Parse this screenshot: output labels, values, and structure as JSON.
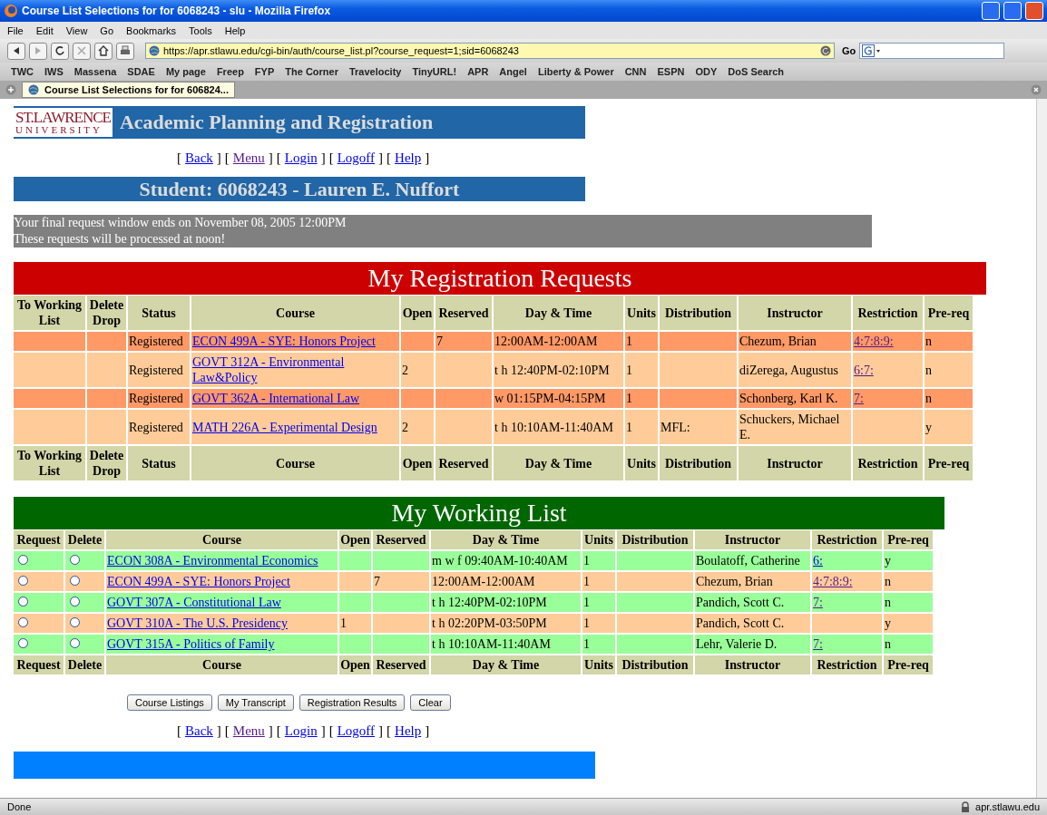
{
  "window": {
    "title": "Course List Selections for for 6068243 - slu - Mozilla Firefox"
  },
  "menu": [
    "File",
    "Edit",
    "View",
    "Go",
    "Bookmarks",
    "Tools",
    "Help"
  ],
  "toolbar": {
    "url": "https://apr.stlawu.edu/cgi-bin/auth/course_list.pl?course_request=1;sid=6068243",
    "go_label": "Go"
  },
  "bookmarks": [
    "TWC",
    "IWS",
    "Massena",
    "SDAE",
    "My page",
    "Freep",
    "FYP",
    "The Corner",
    "Travelocity",
    "TinyURL!",
    "APR",
    "Angel",
    "Liberty & Power",
    "CNN",
    "ESPN",
    "ODY",
    "DoS Search"
  ],
  "tabs": [
    {
      "label": "Course List Selections for for 606824...",
      "selected": true
    }
  ],
  "page": {
    "logo": {
      "line_1": "ST.LAWRENCE",
      "line_2": "UNIVERSITY"
    },
    "title": "Academic Planning and Registration",
    "nav_top": [
      {
        "open": "[",
        "label": "Back",
        "close": "]",
        "visited": false
      },
      {
        "open": "[",
        "label": "Menu",
        "close": "]",
        "visited": true
      },
      {
        "open": "[",
        "label": "Login",
        "close": "]",
        "visited": false
      },
      {
        "open": "[",
        "label": "Logoff",
        "close": "]",
        "visited": false
      },
      {
        "open": "[",
        "label": "Help",
        "close": "]",
        "visited": false
      }
    ],
    "student": "Student: 6068243 - Lauren E. Nuffort",
    "notice": [
      "Your final request window ends on November 08, 2005 12:00PM",
      "These requests will be processed at noon!"
    ],
    "requests": {
      "title": "My Registration Requests",
      "columns": [
        "To Working List",
        "Delete Drop",
        "Status",
        "Course",
        "Open",
        "Reserved",
        "Day & Time",
        "Units",
        "Distribution",
        "Instructor",
        "Restriction",
        "Pre-req"
      ],
      "rows": [
        {
          "color": "#ff9966",
          "cells": [
            {
              "kind": "blank"
            },
            {
              "kind": "blank"
            },
            {
              "kind": "text",
              "text": "Registered"
            },
            {
              "kind": "link",
              "text": "ECON 499A - SYE: Honors Project",
              "visited": false
            },
            {
              "kind": "blank"
            },
            {
              "kind": "text",
              "text": "7"
            },
            {
              "kind": "text",
              "text": "12:00AM-12:00AM"
            },
            {
              "kind": "text",
              "text": "1"
            },
            {
              "kind": "blank"
            },
            {
              "kind": "text",
              "text": "Chezum, Brian"
            },
            {
              "kind": "link",
              "text": "4:7:8:9:",
              "visited": true
            },
            {
              "kind": "text",
              "text": "n"
            }
          ]
        },
        {
          "color": "#ffcc99",
          "cells": [
            {
              "kind": "blank"
            },
            {
              "kind": "blank"
            },
            {
              "kind": "text",
              "text": "Registered"
            },
            {
              "kind": "link",
              "text": "GOVT 312A - Environmental Law&Policy",
              "visited": false
            },
            {
              "kind": "text",
              "text": "2"
            },
            {
              "kind": "blank"
            },
            {
              "kind": "text",
              "text": "t h 12:40PM-02:10PM"
            },
            {
              "kind": "text",
              "text": "1"
            },
            {
              "kind": "blank"
            },
            {
              "kind": "text",
              "text": "diZerega, Augustus"
            },
            {
              "kind": "link",
              "text": "6:7:",
              "visited": true
            },
            {
              "kind": "text",
              "text": "n"
            }
          ]
        },
        {
          "color": "#ff9966",
          "cells": [
            {
              "kind": "blank"
            },
            {
              "kind": "blank"
            },
            {
              "kind": "text",
              "text": "Registered"
            },
            {
              "kind": "link",
              "text": "GOVT 362A - International Law",
              "visited": false
            },
            {
              "kind": "blank"
            },
            {
              "kind": "blank"
            },
            {
              "kind": "text",
              "text": "w 01:15PM-04:15PM"
            },
            {
              "kind": "text",
              "text": "1"
            },
            {
              "kind": "blank"
            },
            {
              "kind": "text",
              "text": "Schonberg, Karl K."
            },
            {
              "kind": "link",
              "text": "7:",
              "visited": true
            },
            {
              "kind": "text",
              "text": "n"
            }
          ]
        },
        {
          "color": "#ffcc99",
          "cells": [
            {
              "kind": "blank"
            },
            {
              "kind": "blank"
            },
            {
              "kind": "text",
              "text": "Registered"
            },
            {
              "kind": "link",
              "text": "MATH 226A - Experimental Design",
              "visited": false
            },
            {
              "kind": "text",
              "text": "2"
            },
            {
              "kind": "blank"
            },
            {
              "kind": "text",
              "text": "t h 10:10AM-11:40AM"
            },
            {
              "kind": "text",
              "text": "1"
            },
            {
              "kind": "text",
              "text": "MFL:"
            },
            {
              "kind": "text",
              "text": "Schuckers, Michael E."
            },
            {
              "kind": "blank"
            },
            {
              "kind": "text",
              "text": "y"
            }
          ]
        }
      ],
      "footer_columns": [
        "To Working List",
        "Delete Drop",
        "Status",
        "Course",
        "Open",
        "Reserved",
        "Day & Time",
        "Units",
        "Distribution",
        "Instructor",
        "Restriction",
        "Pre-req"
      ]
    },
    "working": {
      "title": "My Working List",
      "columns": [
        "Request",
        "Delete",
        "Course",
        "Open",
        "Reserved",
        "Day & Time",
        "Units",
        "Distribution",
        "Instructor",
        "Restriction",
        "Pre-req"
      ],
      "rows": [
        {
          "color": "#99ff99",
          "cells": [
            {
              "kind": "radio",
              "selected": false
            },
            {
              "kind": "radio",
              "selected": false
            },
            {
              "kind": "link",
              "text": "ECON 308A - Environmental Economics",
              "visited": false
            },
            {
              "kind": "blank"
            },
            {
              "kind": "blank"
            },
            {
              "kind": "text",
              "text": "m w f 09:40AM-10:40AM"
            },
            {
              "kind": "text",
              "text": "1"
            },
            {
              "kind": "blank"
            },
            {
              "kind": "text",
              "text": "Boulatoff, Catherine"
            },
            {
              "kind": "link",
              "text": "6:",
              "visited": false
            },
            {
              "kind": "text",
              "text": "y"
            }
          ]
        },
        {
          "color": "#ffcc99",
          "cells": [
            {
              "kind": "radio",
              "selected": false
            },
            {
              "kind": "radio",
              "selected": false
            },
            {
              "kind": "link",
              "text": "ECON 499A - SYE: Honors Project",
              "visited": false
            },
            {
              "kind": "blank"
            },
            {
              "kind": "text",
              "text": "7"
            },
            {
              "kind": "text",
              "text": "12:00AM-12:00AM"
            },
            {
              "kind": "text",
              "text": "1"
            },
            {
              "kind": "blank"
            },
            {
              "kind": "text",
              "text": "Chezum, Brian"
            },
            {
              "kind": "link",
              "text": "4:7:8:9:",
              "visited": true
            },
            {
              "kind": "text",
              "text": "n"
            }
          ]
        },
        {
          "color": "#99ff99",
          "cells": [
            {
              "kind": "radio",
              "selected": false
            },
            {
              "kind": "radio",
              "selected": false
            },
            {
              "kind": "link",
              "text": "GOVT 307A - Constitutional Law",
              "visited": false
            },
            {
              "kind": "blank"
            },
            {
              "kind": "blank"
            },
            {
              "kind": "text",
              "text": "t h 12:40PM-02:10PM"
            },
            {
              "kind": "text",
              "text": "1"
            },
            {
              "kind": "blank"
            },
            {
              "kind": "text",
              "text": "Pandich, Scott C."
            },
            {
              "kind": "link",
              "text": "7:",
              "visited": true
            },
            {
              "kind": "text",
              "text": "n"
            }
          ]
        },
        {
          "color": "#ffcc99",
          "cells": [
            {
              "kind": "radio",
              "selected": false
            },
            {
              "kind": "radio",
              "selected": false
            },
            {
              "kind": "link",
              "text": "GOVT 310A - The U.S. Presidency",
              "visited": false
            },
            {
              "kind": "text",
              "text": "1"
            },
            {
              "kind": "blank"
            },
            {
              "kind": "text",
              "text": "t h 02:20PM-03:50PM"
            },
            {
              "kind": "text",
              "text": "1"
            },
            {
              "kind": "blank"
            },
            {
              "kind": "text",
              "text": "Pandich, Scott C."
            },
            {
              "kind": "blank"
            },
            {
              "kind": "text",
              "text": "y"
            }
          ]
        },
        {
          "color": "#99ff99",
          "cells": [
            {
              "kind": "radio",
              "selected": false
            },
            {
              "kind": "radio",
              "selected": false
            },
            {
              "kind": "link",
              "text": "GOVT 315A - Politics of Family",
              "visited": false
            },
            {
              "kind": "blank"
            },
            {
              "kind": "blank"
            },
            {
              "kind": "text",
              "text": "t h 10:10AM-11:40AM"
            },
            {
              "kind": "text",
              "text": "1"
            },
            {
              "kind": "blank"
            },
            {
              "kind": "text",
              "text": "Lehr, Valerie D."
            },
            {
              "kind": "link",
              "text": "7:",
              "visited": true
            },
            {
              "kind": "text",
              "text": "n"
            }
          ]
        }
      ],
      "footer_columns": [
        "Request",
        "Delete",
        "Course",
        "Open",
        "Reserved",
        "Day & Time",
        "Units",
        "Distribution",
        "Instructor",
        "Restriction",
        "Pre-req"
      ]
    },
    "buttons": [
      "Course Listings",
      "My Transcript",
      "Registration Results",
      "Clear"
    ],
    "nav_bottom": [
      {
        "open": "[",
        "label": "Back",
        "close": "]",
        "visited": false
      },
      {
        "open": "[",
        "label": "Menu",
        "close": "]",
        "visited": true
      },
      {
        "open": "[",
        "label": "Login",
        "close": "]",
        "visited": false
      },
      {
        "open": "[",
        "label": "Logoff",
        "close": "]",
        "visited": false
      },
      {
        "open": "[",
        "label": "Help",
        "close": "]",
        "visited": false
      }
    ]
  },
  "status_bar": {
    "text": "Done",
    "site": "apr.stlawu.edu"
  }
}
